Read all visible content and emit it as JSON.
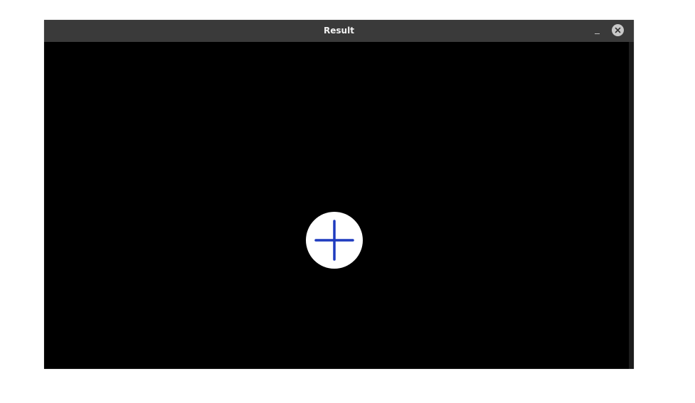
{
  "window": {
    "title": "Result",
    "controls": {
      "minimize": "minimize-icon",
      "close": "close-icon"
    }
  },
  "canvas": {
    "background": "#000000",
    "marker": {
      "icon": "plus-icon",
      "circle_color": "#ffffff",
      "plus_color": "#1f3bbf"
    }
  }
}
